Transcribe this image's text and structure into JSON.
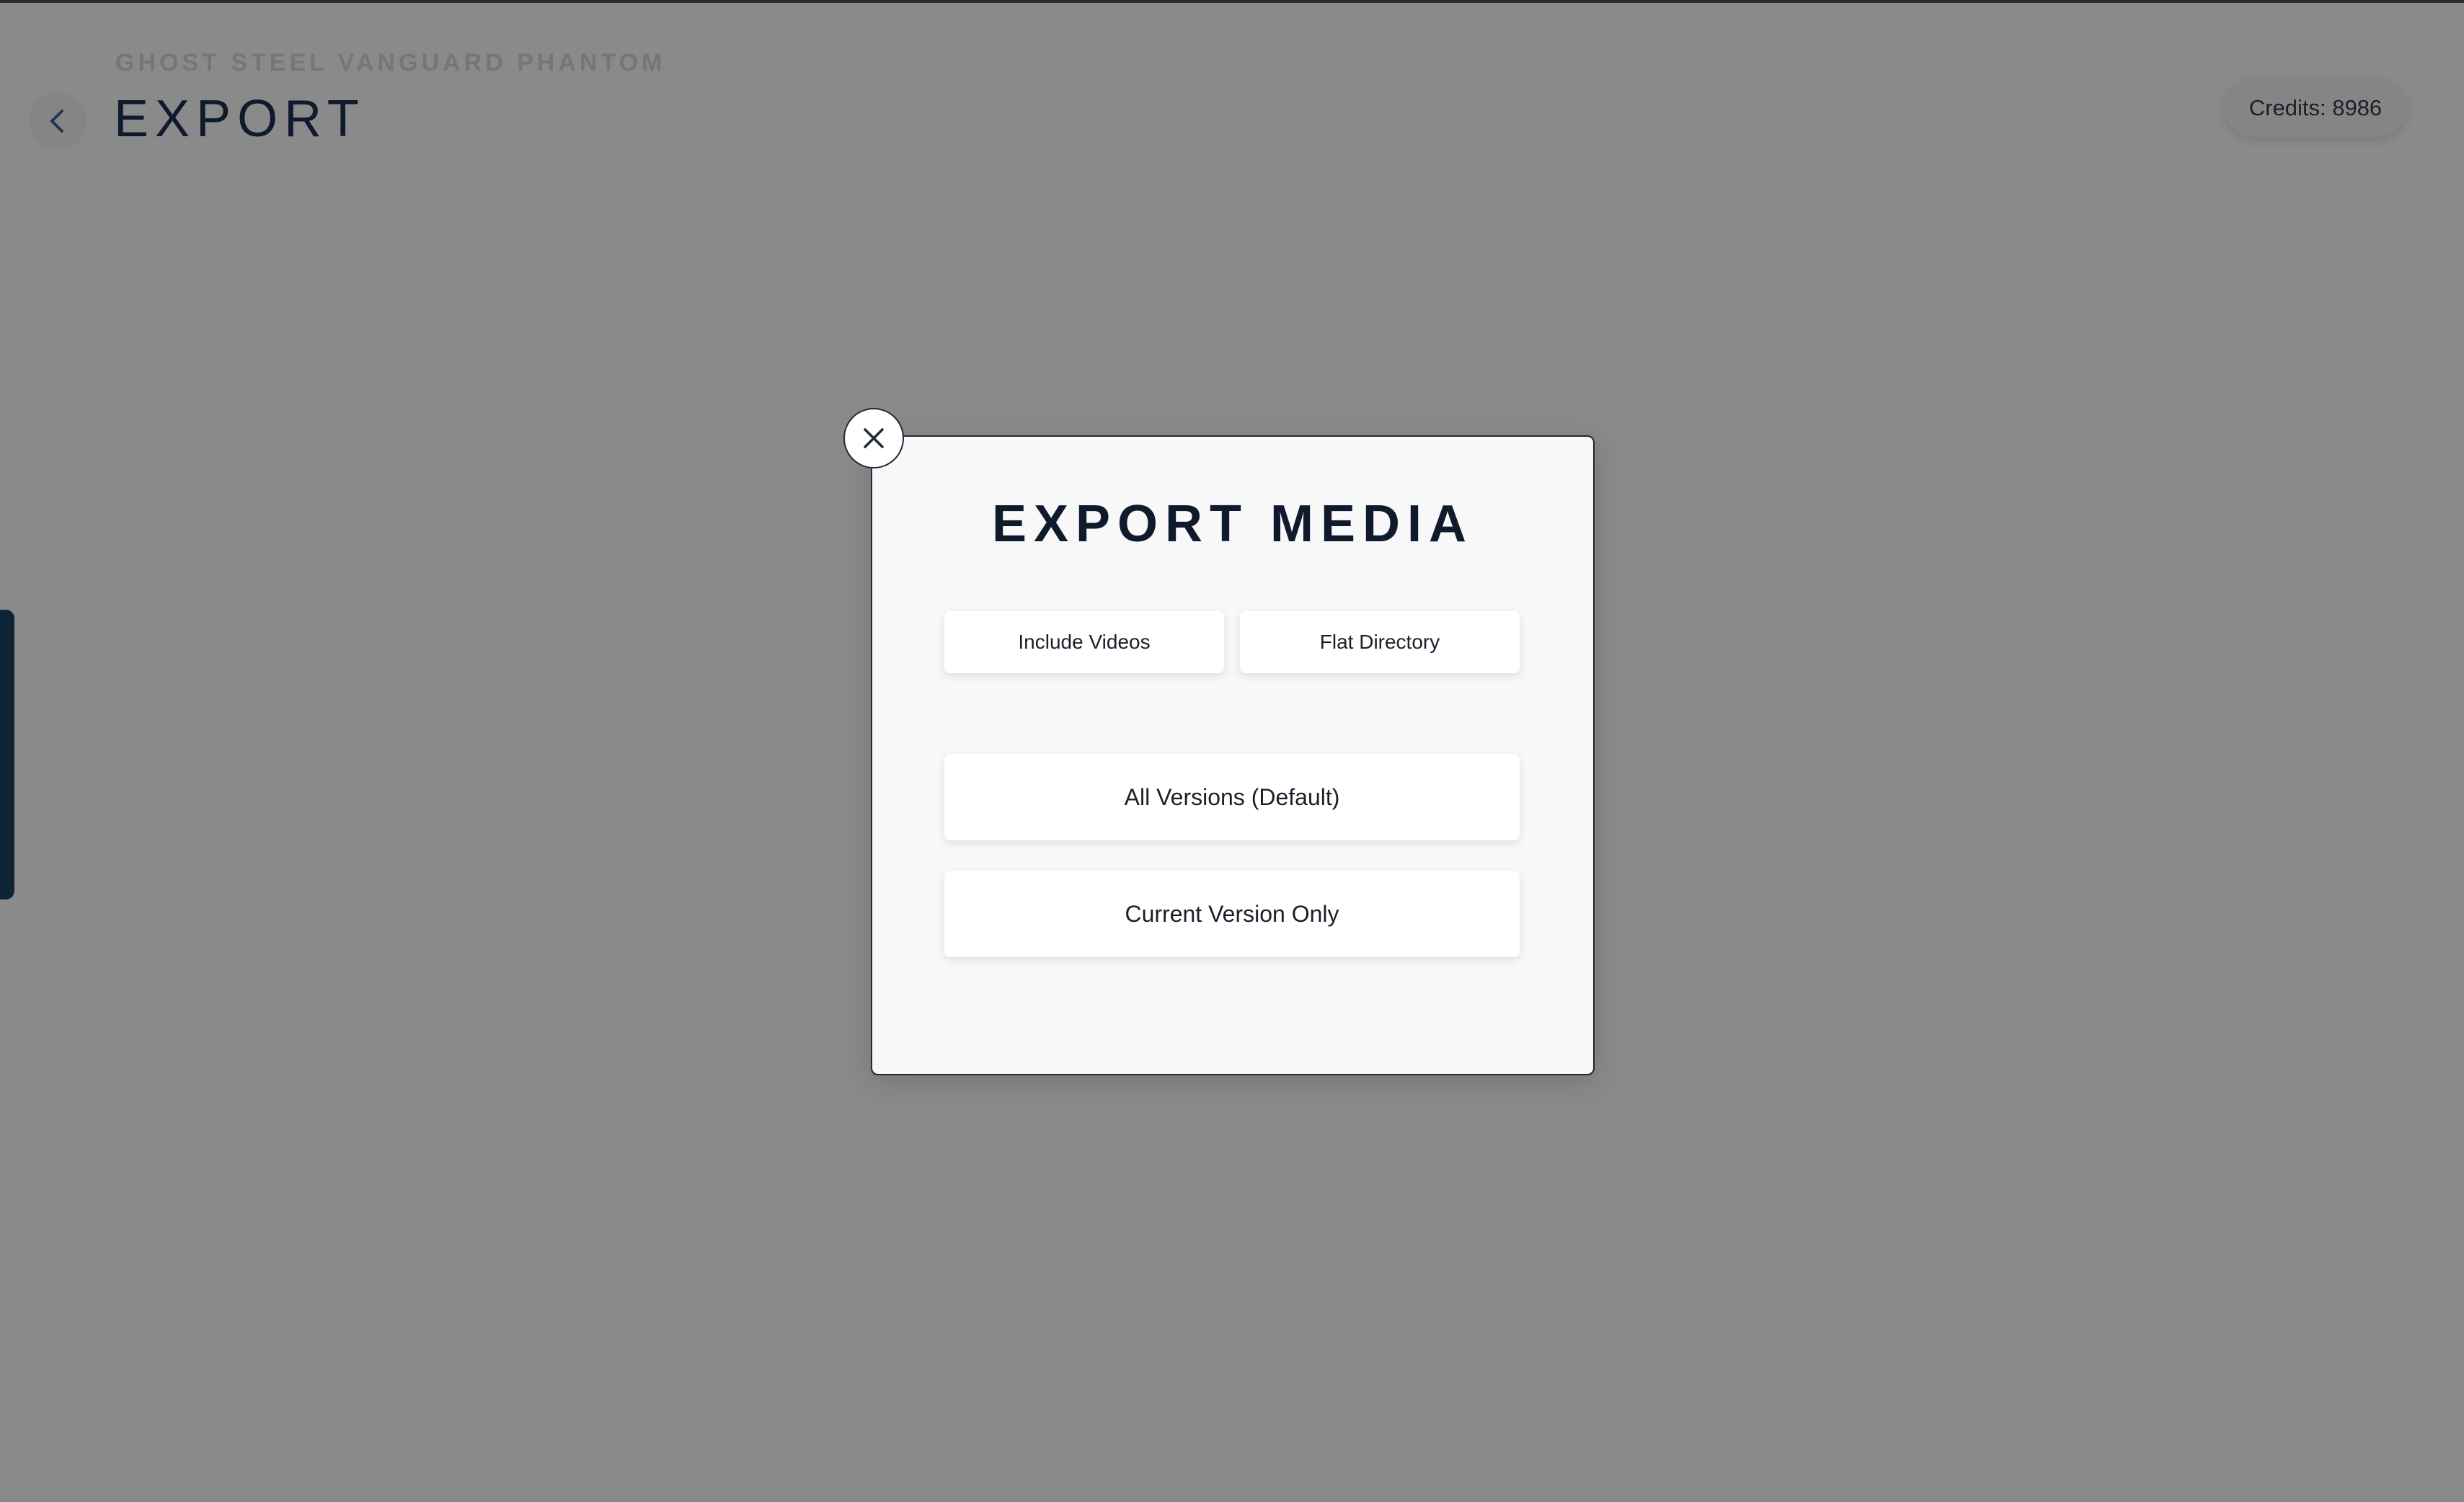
{
  "header": {
    "supertitle": "GHOST STEEL VANGUARD PHANTOM",
    "title": "EXPORT",
    "back_icon": "chevron-left-icon",
    "credits": "Credits: 8986"
  },
  "modal": {
    "title": "EXPORT MEDIA",
    "close_icon": "close-icon",
    "toggle_options": [
      "Include Videos",
      "Flat Directory"
    ],
    "version_options": [
      "All Versions (Default)",
      "Current Version Only"
    ]
  },
  "colors": {
    "overlay_bg": "#8a8a8a",
    "modal_bg": "#f8f8f8",
    "title_text": "#0f1a2c",
    "side_tab": "#0d2336"
  }
}
